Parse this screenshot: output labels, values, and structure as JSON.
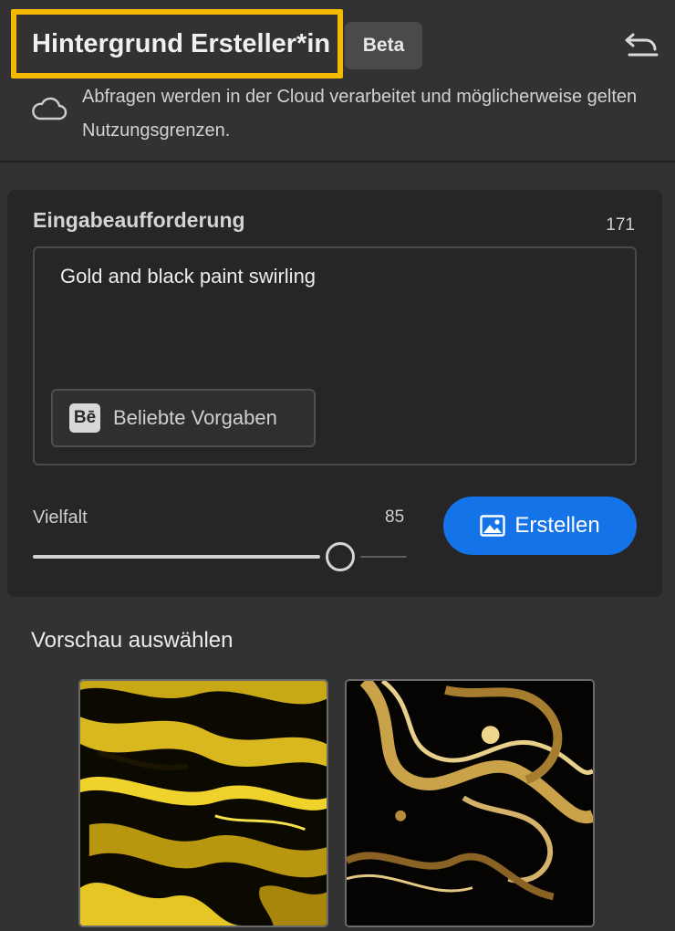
{
  "header": {
    "title": "Hintergrund Ersteller*in",
    "badge": "Beta",
    "undo_icon": "undo-icon",
    "cloud_icon": "cloud-icon",
    "cloud_note": "Abfragen werden in der Cloud verarbeitet und möglicherweise gelten Nutzungsgrenzen."
  },
  "prompt": {
    "heading": "Eingabeaufforderung",
    "remaining_chars": "171",
    "value": "Gold and black paint swirling",
    "presets_icon_text": "Bē",
    "presets_label": "Beliebte Vorgaben"
  },
  "variety": {
    "label": "Vielfalt",
    "value": "85",
    "level": 0.85
  },
  "create_button": {
    "label": "Erstellen",
    "icon": "image-icon"
  },
  "preview": {
    "heading": "Vorschau auswählen",
    "thumbnails": [
      "thumbnail-gold-marble-1",
      "thumbnail-gold-swirl-2"
    ]
  },
  "colors": {
    "background": "#323232",
    "card": "#262626",
    "accent": "#1473e6",
    "highlight": "#f5b800"
  }
}
